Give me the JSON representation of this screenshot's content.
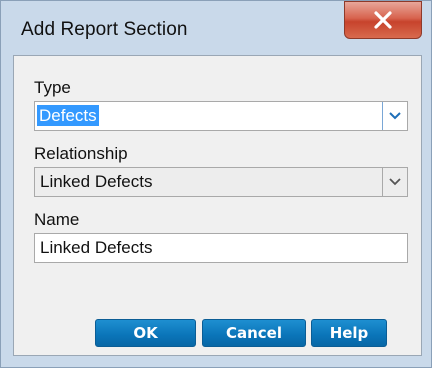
{
  "window": {
    "title": "Add Report Section",
    "close_label": "X"
  },
  "form": {
    "type": {
      "label": "Type",
      "value": "Defects",
      "icon": "chevron-down-icon"
    },
    "relationship": {
      "label": "Relationship",
      "value": "Linked Defects",
      "icon": "chevron-down-icon"
    },
    "name": {
      "label": "Name",
      "value": "Linked Defects"
    }
  },
  "buttons": {
    "ok": "OK",
    "cancel": "Cancel",
    "help": "Help"
  },
  "colors": {
    "button_blue": "#0a74b8",
    "close_red": "#c7432c",
    "selection": "#3399ff"
  }
}
